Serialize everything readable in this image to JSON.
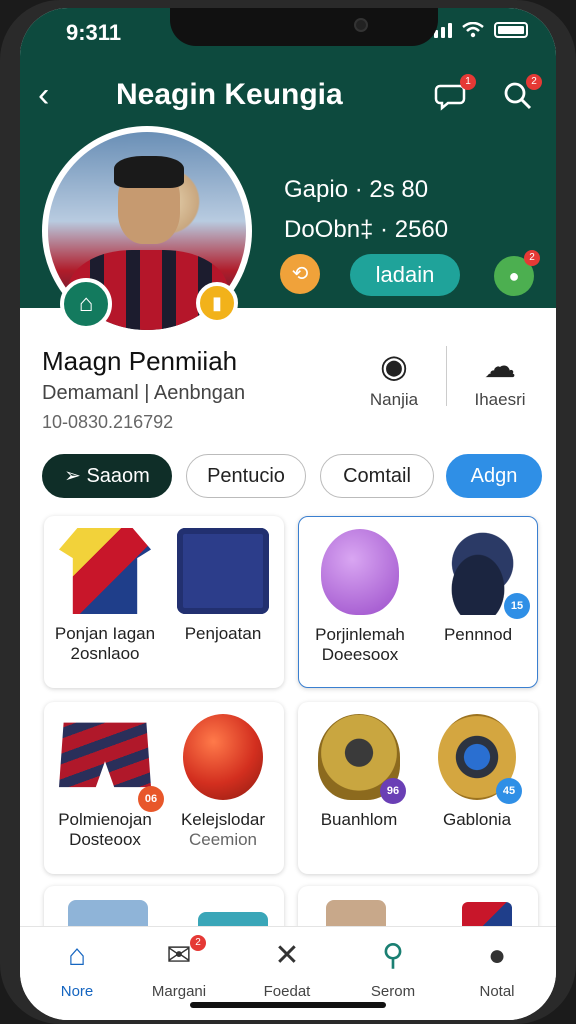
{
  "status": {
    "time": "9:311"
  },
  "header": {
    "title": "Neagin Keungia",
    "badge_messages": "1",
    "badge_search": "2",
    "stat_1": "Gapio · 2s 80",
    "stat_2": "DoObn‡ · 2560",
    "action_button": "ladain",
    "green_badge": "2"
  },
  "profile": {
    "name": "Maagn Penmiiah",
    "subtitle": "Demamanl | Aenbngan",
    "phone": "10-0830.216792",
    "side_action_1": "Nanjia",
    "side_action_2": "Ihaesri"
  },
  "pills": [
    "Saaom",
    "Pentucio",
    "Comtail",
    "Adgn"
  ],
  "cards": [
    {
      "items": [
        {
          "label": "Ponjan Iagan",
          "label2": "2osnlaoo"
        },
        {
          "label": "Penjoatan",
          "label2": ""
        }
      ]
    },
    {
      "items": [
        {
          "label": "Porjinlemah",
          "label2": "Doeesoox"
        },
        {
          "label": "Pennnod",
          "label2": "",
          "badge": "15"
        }
      ]
    },
    {
      "items": [
        {
          "label": "Polmienojan",
          "label2": "Dosteoox",
          "badge": "06"
        },
        {
          "label": "Kelejslodar",
          "label2": "Ceemion"
        }
      ]
    },
    {
      "items": [
        {
          "label": "Buanhlom",
          "label2": "",
          "badge": "96"
        },
        {
          "label": "Gablonia",
          "label2": "",
          "badge": "45"
        }
      ]
    }
  ],
  "tabs": [
    {
      "label": "Nore",
      "icon": "home-icon"
    },
    {
      "label": "Margani",
      "icon": "mail-icon",
      "badge": "2"
    },
    {
      "label": "Foedat",
      "icon": "crossed-tools-icon"
    },
    {
      "label": "Serom",
      "icon": "search-icon"
    },
    {
      "label": "Notal",
      "icon": "profile-icon"
    }
  ],
  "colors": {
    "header": "#0d4a3e",
    "accent_blue": "#2f8fe6",
    "teal": "#1fa39a"
  }
}
